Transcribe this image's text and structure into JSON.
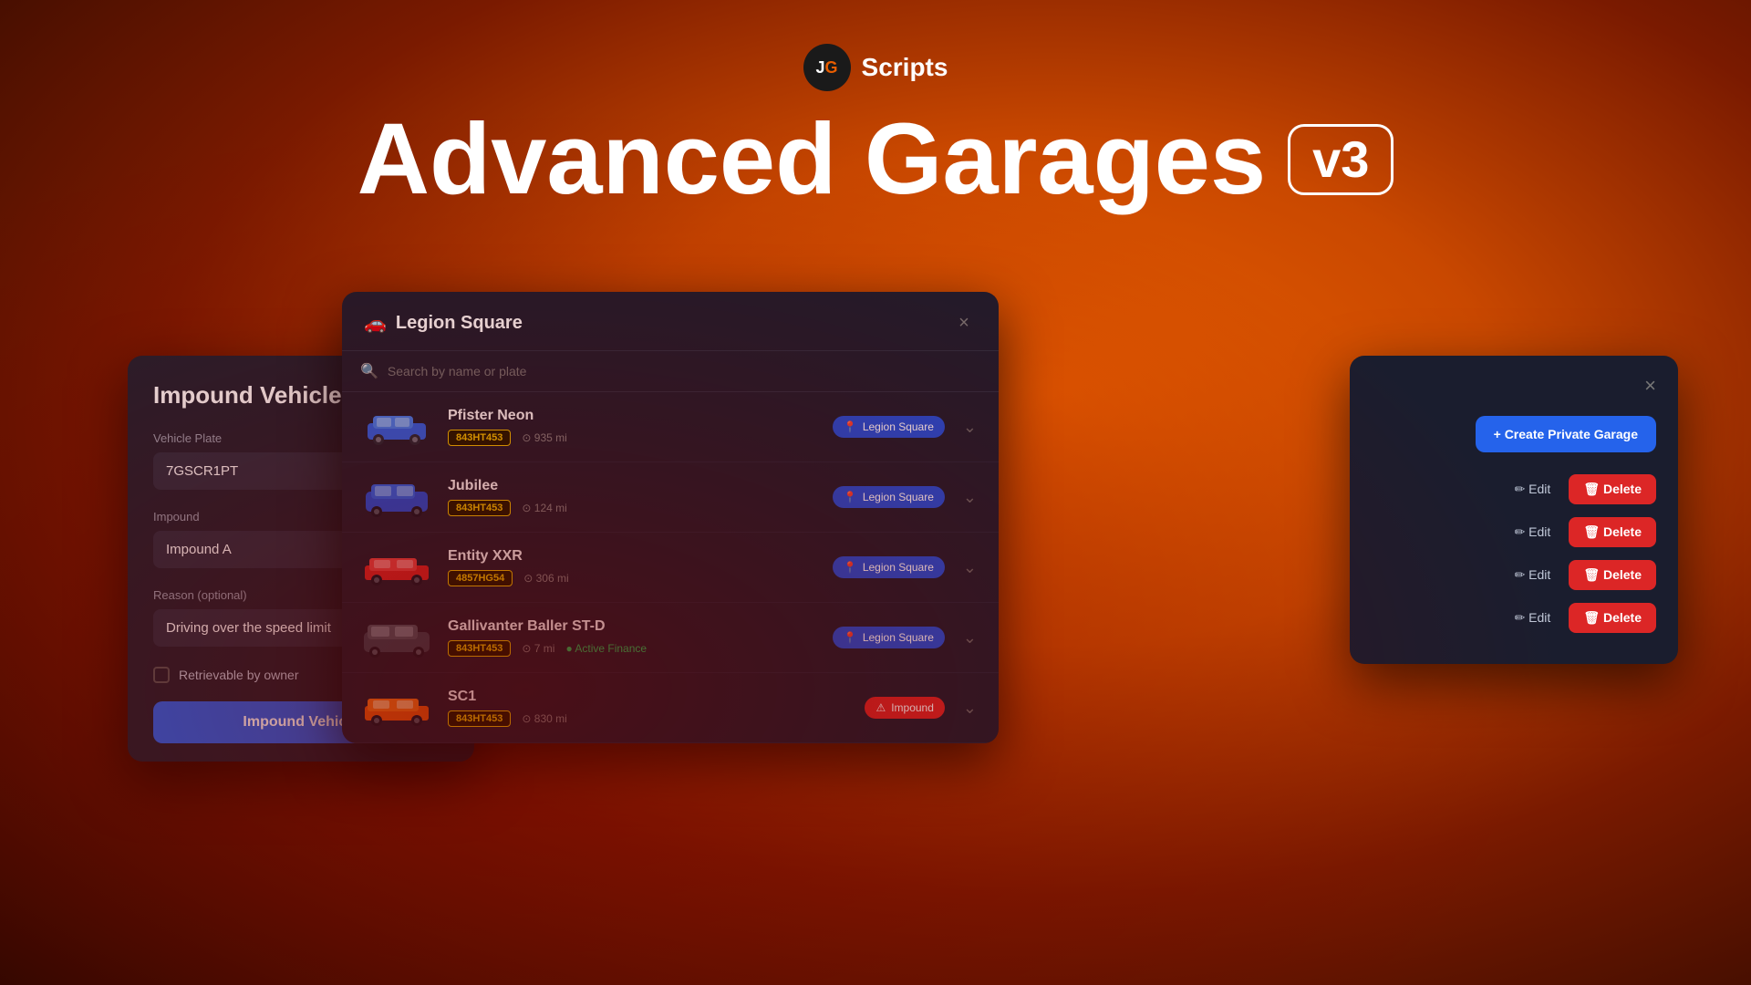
{
  "header": {
    "logo_text": "JG",
    "brand_name": "Scripts",
    "main_title": "Advanced Garages",
    "version_badge": "v3"
  },
  "garage_panel": {
    "title": "Legion Square",
    "close_label": "×",
    "search": {
      "placeholder": "Search by name or plate"
    },
    "vehicles": [
      {
        "name": "Pfister Neon",
        "plate": "843HT453",
        "mileage": "935 mi",
        "location": "Legion Square",
        "location_type": "normal",
        "color": "blue",
        "finance": null
      },
      {
        "name": "Jubilee",
        "plate": "843HT453",
        "mileage": "124 mi",
        "location": "Legion Square",
        "location_type": "normal",
        "color": "dark-blue",
        "finance": null
      },
      {
        "name": "Entity XXR",
        "plate": "4857HG54",
        "mileage": "306 mi",
        "location": "Legion Square",
        "location_type": "normal",
        "color": "red",
        "finance": null
      },
      {
        "name": "Gallivanter Baller ST-D",
        "plate": "843HT453",
        "mileage": "7 mi",
        "location": "Legion Square",
        "location_type": "normal",
        "color": "dark",
        "finance": "Active Finance"
      },
      {
        "name": "SC1",
        "plate": "843HT453",
        "mileage": "830 mi",
        "location": "Impound",
        "location_type": "impound",
        "color": "orange",
        "finance": null
      }
    ]
  },
  "impound_panel": {
    "title": "Impound Vehicle",
    "vehicle_plate_label": "Vehicle Plate",
    "vehicle_plate_value": "7GSCR1PT",
    "impound_label": "Impound",
    "impound_value": "Impound A",
    "reason_label": "Reason (optional)",
    "reason_value": "Driving over the speed limit",
    "retrievable_label": "Retrievable by owner",
    "button_label": "Impound Vehicle"
  },
  "right_panel": {
    "create_btn_label": "+ Create Private Garage",
    "close_label": "×",
    "action_rows": [
      {
        "edit_label": "Edit",
        "delete_label": "Delete"
      },
      {
        "edit_label": "Edit",
        "delete_label": "Delete"
      },
      {
        "edit_label": "Edit",
        "delete_label": "Delete"
      },
      {
        "edit_label": "Edit",
        "delete_label": "Delete"
      }
    ]
  },
  "icons": {
    "search": "🔍",
    "car": "🚗",
    "pin": "📍",
    "warning": "⚠",
    "plus": "+",
    "edit": "✏",
    "delete": "🗑",
    "chevron_down": "⌄",
    "check": "✓"
  }
}
